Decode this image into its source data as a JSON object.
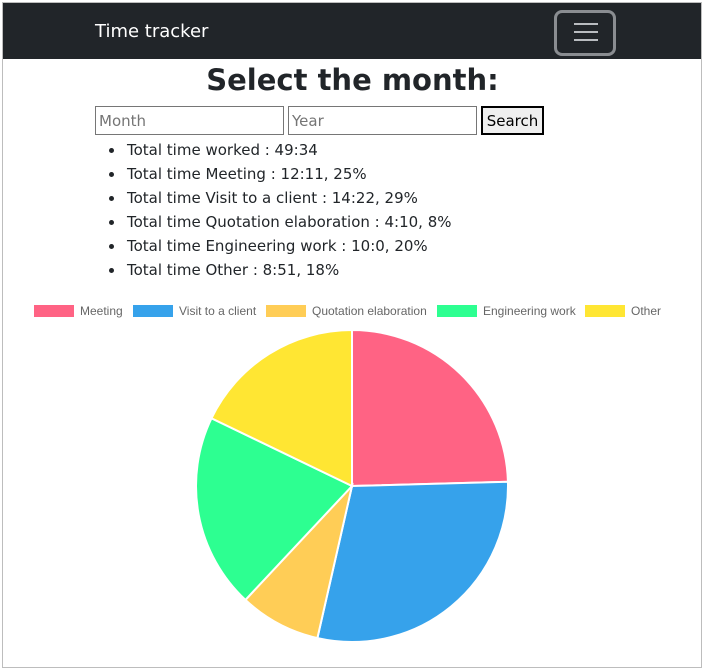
{
  "navbar": {
    "brand": "Time tracker",
    "toggler_icon": "hamburger-icon"
  },
  "page": {
    "heading": "Select the month:"
  },
  "search": {
    "month_placeholder": "Month",
    "month_value": "",
    "year_placeholder": "Year",
    "year_value": "",
    "button_label": "Search"
  },
  "totals": [
    "Total time worked : 49:34",
    "Total time Meeting : 12:11, 25%",
    "Total time Visit to a client : 14:22, 29%",
    "Total time Quotation elaboration : 4:10, 8%",
    "Total time Engineering work : 10:0, 20%",
    "Total time Other : 8:51, 18%"
  ],
  "chart_data": {
    "type": "pie",
    "title": "",
    "legend_position": "top",
    "categories": [
      "Meeting",
      "Visit to a client",
      "Quotation elaboration",
      "Engineering work",
      "Other"
    ],
    "values": [
      12.18,
      14.37,
      4.17,
      10.0,
      8.85
    ],
    "colors": [
      "#ff6384",
      "#36a2eb",
      "#ffcd56",
      "#2dff91",
      "#ffe633"
    ]
  }
}
